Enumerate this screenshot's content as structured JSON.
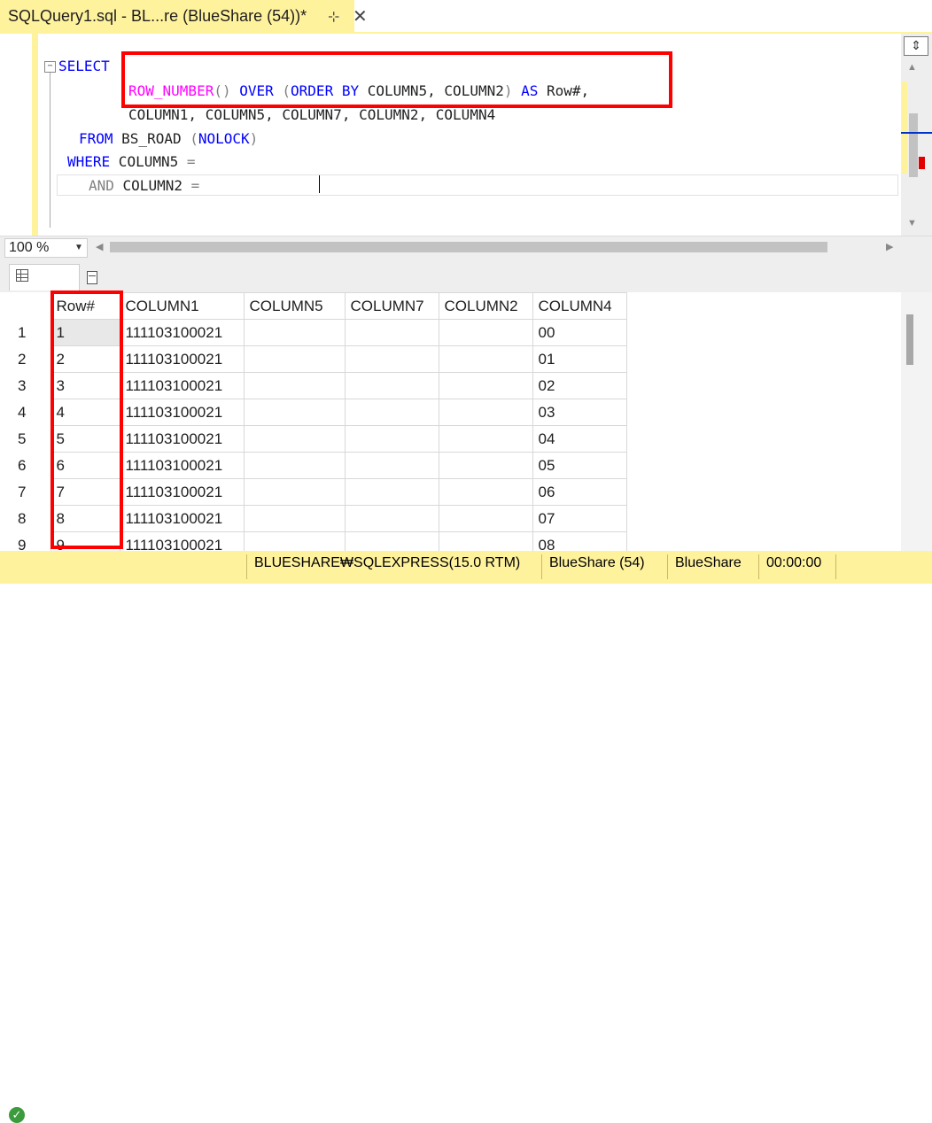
{
  "tab": {
    "title": "SQLQuery1.sql - BL...re (BlueShare (54))*",
    "pin": "⊹",
    "close": "✕"
  },
  "editor": {
    "collapse": "−",
    "lines": {
      "l1_kw": "SELECT",
      "l1_comment": "",
      "l2_fn": "ROW_NUMBER",
      "l2_p1": "() ",
      "l2_over": "OVER",
      "l2_p2": " (",
      "l2_order": "ORDER BY",
      "l2_cols": " COLUMN5, COLUMN2",
      "l2_p3": ") ",
      "l2_as": "AS",
      "l2_alias": " Row#,",
      "l3": "COLUMN1, COLUMN5, COLUMN7, COLUMN2, COLUMN4",
      "l4_kw": "FROM",
      "l4_table": " BS_ROAD ",
      "l4_p1": "(",
      "l4_hint": "NOLOCK",
      "l4_p2": ")",
      "l5_kw": "WHERE",
      "l5_col": " COLUMN5 ",
      "l5_eq": "=",
      "l5_val": "",
      "l6_kw": "AND",
      "l6_col": " COLUMN2 ",
      "l6_eq": "=",
      "l6_val": ""
    }
  },
  "zoom": {
    "value": "100 %"
  },
  "results_tabs": {
    "results": "",
    "messages": ""
  },
  "grid": {
    "headers": [
      "Row#",
      "COLUMN1",
      "COLUMN5",
      "COLUMN7",
      "COLUMN2",
      "COLUMN4"
    ],
    "rows": [
      {
        "n": "1",
        "c": [
          "1",
          "111103100021",
          "",
          "",
          "",
          "00"
        ]
      },
      {
        "n": "2",
        "c": [
          "2",
          "111103100021",
          "",
          "",
          "",
          "01"
        ]
      },
      {
        "n": "3",
        "c": [
          "3",
          "111103100021",
          "",
          "",
          "",
          "02"
        ]
      },
      {
        "n": "4",
        "c": [
          "4",
          "111103100021",
          "",
          "",
          "",
          "03"
        ]
      },
      {
        "n": "5",
        "c": [
          "5",
          "111103100021",
          "",
          "",
          "",
          "04"
        ]
      },
      {
        "n": "6",
        "c": [
          "6",
          "111103100021",
          "",
          "",
          "",
          "05"
        ]
      },
      {
        "n": "7",
        "c": [
          "7",
          "111103100021",
          "",
          "",
          "",
          "06"
        ]
      },
      {
        "n": "8",
        "c": [
          "8",
          "111103100021",
          "",
          "",
          "",
          "07"
        ]
      },
      {
        "n": "9",
        "c": [
          "9",
          "111103100021",
          "",
          "",
          "",
          "08"
        ]
      }
    ]
  },
  "status": {
    "ok_icon": "✓",
    "message": "",
    "server": "BLUESHARE₩SQLEXPRESS(15.0 RTM)",
    "db_user": "BlueShare (54)",
    "database": "BlueShare",
    "elapsed": "00:00:00",
    "rows": ""
  }
}
